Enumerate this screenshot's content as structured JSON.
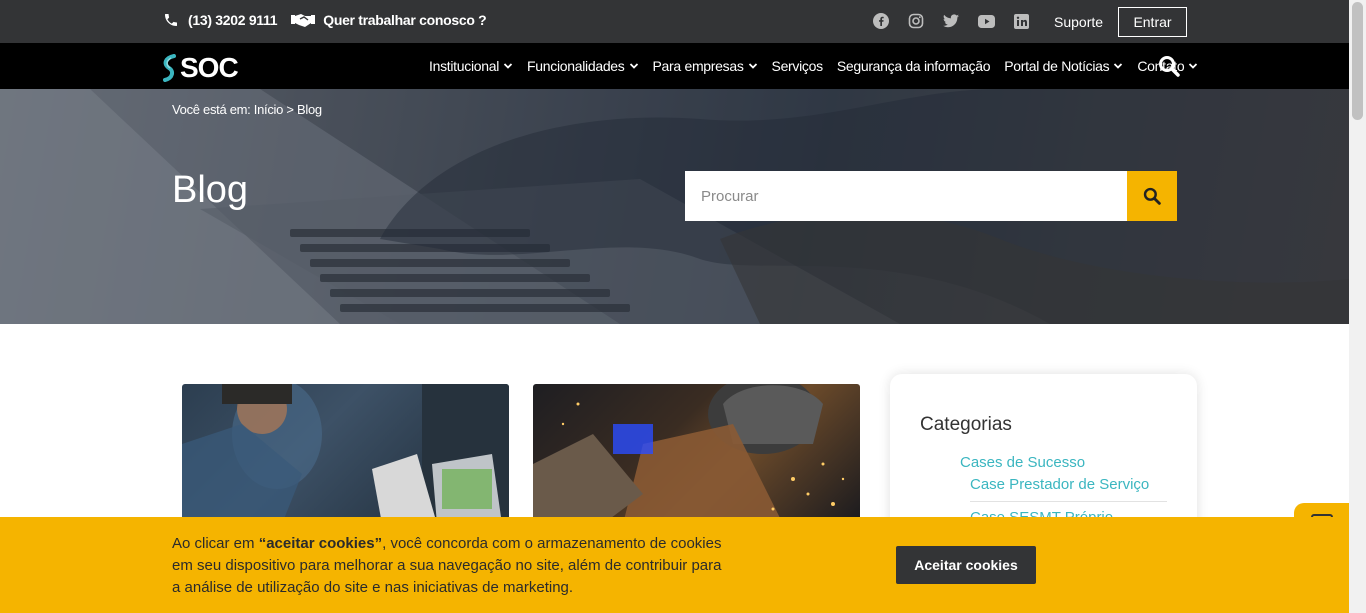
{
  "topbar": {
    "phone": "(13) 3202 9111",
    "work_with_us": "Quer trabalhar conosco ?",
    "social_icons": [
      "facebook-icon",
      "instagram-icon",
      "twitter-icon",
      "youtube-icon",
      "linkedin-icon"
    ],
    "support": "Suporte",
    "login": "Entrar"
  },
  "nav": {
    "logo_text": "SOC",
    "items": [
      {
        "label": "Institucional",
        "dropdown": true
      },
      {
        "label": "Funcionalidades",
        "dropdown": true
      },
      {
        "label": "Para empresas",
        "dropdown": true
      },
      {
        "label": "Serviços",
        "dropdown": false
      },
      {
        "label": "Segurança da informação",
        "dropdown": false
      },
      {
        "label": "Portal de Notícias",
        "dropdown": true
      },
      {
        "label": "Contato",
        "dropdown": true
      }
    ]
  },
  "hero": {
    "breadcrumb": "Você está em: Início > Blog",
    "title": "Blog",
    "search_placeholder": "Procurar"
  },
  "sidebar": {
    "title": "Categorias",
    "category": "Cases de Sucesso",
    "sub1": "Case Prestador de Serviço",
    "sub2": "Case SESMT Próprio"
  },
  "cookie": {
    "prefix": "Ao clicar em ",
    "bold": "“aceitar cookies”",
    "suffix": ", você concorda com o armazenamento de cookies em seu dispositivo para melhorar a sua navegação no site, além de contribuir para a análise de utilização do site e nas iniciativas de marketing.",
    "button": "Aceitar cookies"
  },
  "colors": {
    "accent": "#f5b400",
    "topbar": "#333436",
    "nav": "#000000",
    "link": "#3bb6c0"
  }
}
